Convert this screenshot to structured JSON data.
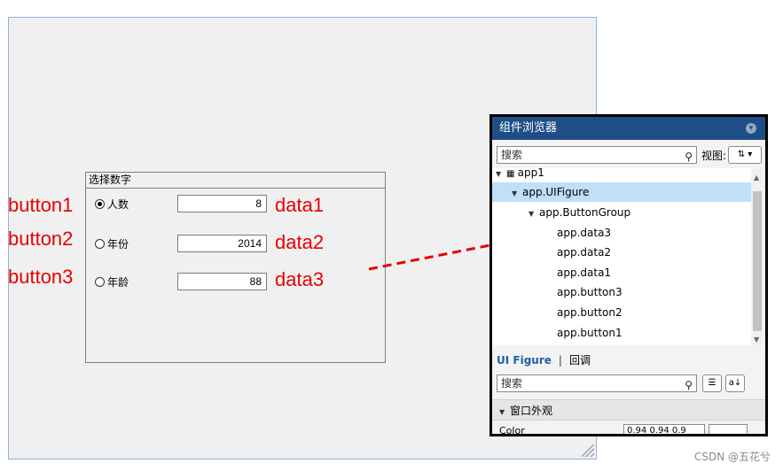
{
  "canvas": {
    "group_title": "选择数字",
    "rows": [
      {
        "radio_label": "人数",
        "value": "8",
        "checked": true
      },
      {
        "radio_label": "年份",
        "value": "2014",
        "checked": false
      },
      {
        "radio_label": "年龄",
        "value": "88",
        "checked": false
      }
    ]
  },
  "annotations": {
    "buttons": [
      "button1",
      "button2",
      "button3"
    ],
    "data": [
      "data1",
      "data2",
      "data3"
    ],
    "arrow_color": "#e60000"
  },
  "panel": {
    "title": "组件浏览器",
    "search_placeholder": "搜索",
    "view_label": "视图:",
    "tree": [
      {
        "label": "app1",
        "level": 0,
        "expanded": true,
        "selected": false
      },
      {
        "label": "app.UIFigure",
        "level": 1,
        "expanded": true,
        "selected": true
      },
      {
        "label": "app.ButtonGroup",
        "level": 2,
        "expanded": true,
        "selected": false
      },
      {
        "label": "app.data3",
        "level": 3,
        "selected": false
      },
      {
        "label": "app.data2",
        "level": 3,
        "selected": false
      },
      {
        "label": "app.data1",
        "level": 3,
        "selected": false
      },
      {
        "label": "app.button3",
        "level": 3,
        "selected": false
      },
      {
        "label": "app.button2",
        "level": 3,
        "selected": false
      },
      {
        "label": "app.button1",
        "level": 3,
        "selected": false
      }
    ],
    "tabs": {
      "active": "UI Figure",
      "other": "回调"
    },
    "search2_placeholder": "搜索",
    "section_label": "窗口外观",
    "property_name": "Color",
    "property_value": "0.94 0.94 0.9",
    "header_color": "#1f4e87",
    "selection_color": "#bfe0f8"
  },
  "watermark": "CSDN @五花兮"
}
